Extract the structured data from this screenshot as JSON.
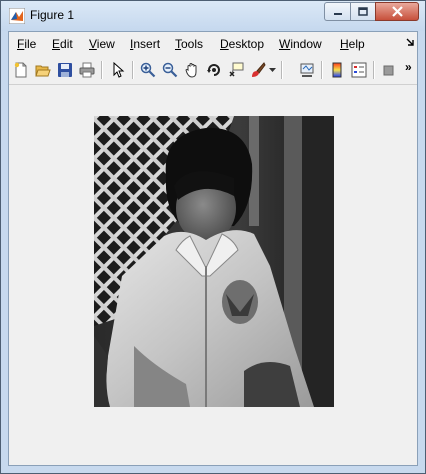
{
  "window": {
    "title": "Figure 1"
  },
  "menu": {
    "items": [
      {
        "label": "File",
        "mnemonic": "F",
        "rest": "ile"
      },
      {
        "label": "Edit",
        "mnemonic": "E",
        "rest": "dit"
      },
      {
        "label": "View",
        "mnemonic": "V",
        "rest": "iew"
      },
      {
        "label": "Insert",
        "mnemonic": "I",
        "rest": "nsert"
      },
      {
        "label": "Tools",
        "mnemonic": "T",
        "rest": "ools"
      },
      {
        "label": "Desktop",
        "mnemonic": "D",
        "rest": "esktop"
      },
      {
        "label": "Window",
        "mnemonic": "W",
        "rest": "indow"
      },
      {
        "label": "Help",
        "mnemonic": "H",
        "rest": "elp"
      }
    ]
  },
  "toolbar": {
    "tools": [
      "new-figure-icon",
      "open-file-icon",
      "save-figure-icon",
      "print-figure-icon",
      "edit-plot-arrow-icon",
      "zoom-in-icon",
      "zoom-out-icon",
      "pan-hand-icon",
      "rotate-3d-icon",
      "data-cursor-icon",
      "brush-icon",
      "brush-dropdown-icon",
      "link-plot-icon",
      "insert-colorbar-icon",
      "insert-legend-icon",
      "hide-plot-tools-icon",
      "toolbar-overflow-icon"
    ]
  },
  "colors": {
    "titlebar": "#c5d8ee",
    "close_button": "#c7503b",
    "figure_background": "#f0f0f0"
  },
  "content": {
    "image_kind": "grayscale photograph in figure axes"
  }
}
